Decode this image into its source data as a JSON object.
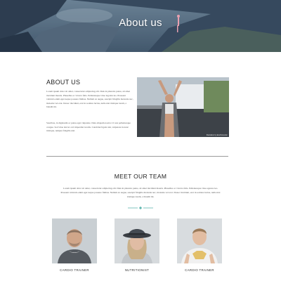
{
  "hero": {
    "title": "About us"
  },
  "about": {
    "heading": "ABOUT US",
    "paragraph1": "Lorem ipsum dolor sit amet, consectetur adipiscing elit. Duis in pharetra purus, sit amet tincidunt mauris. Phasellus ac viverra felis. Pellentesque vitae lagolan leo. Praesent vehicula enim eget neque posuere finibus. Nullam ex augue, suscipit fringilla molestie nec, molestie vel erat. Donec tincidunt, erat in sodales luctus, nulla nisi tristique lorem, a blandit mi.",
    "paragraph2": "Suscibus, in dignissim ac purus eget vulputate. Duis aliquam nostra t il non pellentesque congue. Sed vitae nisl ut orci imperdiet iaculis. Curabitur ligula nisi, vulputate in nunc tristique, tempus fringilla nisl.",
    "photo_caption": "Illustration by Eva Romerton"
  },
  "team": {
    "heading": "MEET OUR TEAM",
    "text": "Lorem ipsum dolor sit amet, consectetur adipiscing elit. Duis in pharetra purus, sit amet tincidunt mauris. Phasellus ac viverra felis. Pellentesque vitae egestas leo. Praesent vehicula enim eget neque posuere finibus. Nullam ex augue, suscipit fringilla molestie nec, molestie vel erat. Donec tincidunt, erat in sodales luctus, nulla nisi tristique lorem, a blandit mi.",
    "members": [
      {
        "role": "CARDIO TRAINER"
      },
      {
        "role": "NUTRITIONIST"
      },
      {
        "role": "CARDIO TRAINER"
      }
    ]
  },
  "colors": {
    "accent": "#5fb7b0",
    "divider": "#9a9a9a",
    "hero_overlay": "#2c3e5a"
  }
}
